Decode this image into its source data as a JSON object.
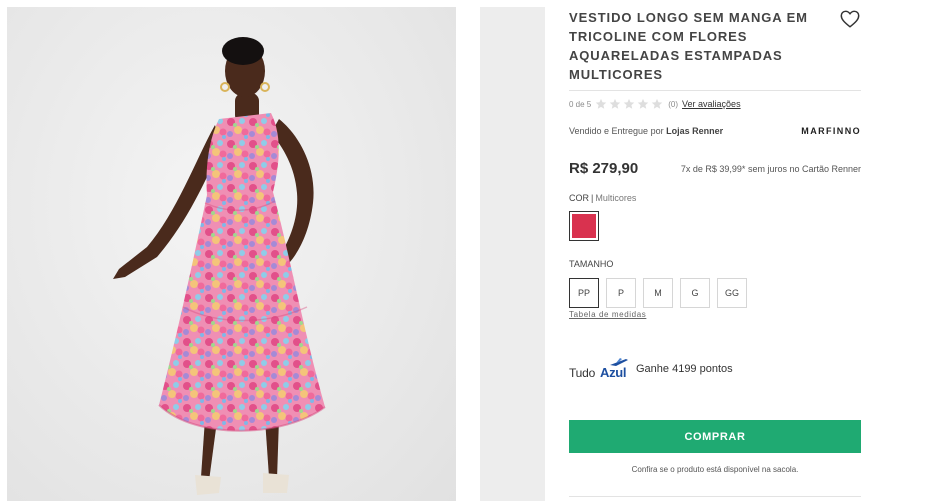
{
  "product": {
    "title": "VESTIDO LONGO SEM MANGA EM TRICOLINE COM FLORES AQUARELADAS ESTAMPADAS MULTICORES",
    "rating": {
      "score_text": "0 de 5",
      "stars": 5,
      "filled": 0,
      "count_text": "(0)",
      "reviews_link": "Ver avaliações"
    },
    "seller_prefix": "Vendido e Entregue por",
    "seller_name": "Lojas Renner",
    "brand": "MARFINNO",
    "price": "R$ 279,90",
    "installments": "7x de R$ 39,99* sem juros no Cartão Renner",
    "color": {
      "label": "COR",
      "separator": "|",
      "value": "Multicores",
      "swatch_hex": "#d9324f"
    },
    "size": {
      "label": "TAMANHO",
      "options": [
        "PP",
        "P",
        "M",
        "G",
        "GG"
      ],
      "selected": "PP",
      "table_link": "Tabela de medidas"
    },
    "loyalty": {
      "logo_part1": "Tudo",
      "logo_part2": "Azul",
      "points_text": "Ganhe 4199 pontos"
    },
    "buy_button": "COMPRAR",
    "availability_note": "Confira se o produto está disponível na sacola."
  },
  "colors": {
    "buy_green": "#1faa72",
    "star_empty": "#dedede",
    "tudoazul_blue": "#1d4fa0"
  },
  "icons": {
    "favorite": "heart-outline-icon",
    "star": "star-icon",
    "loyalty_plane": "plane-icon"
  }
}
